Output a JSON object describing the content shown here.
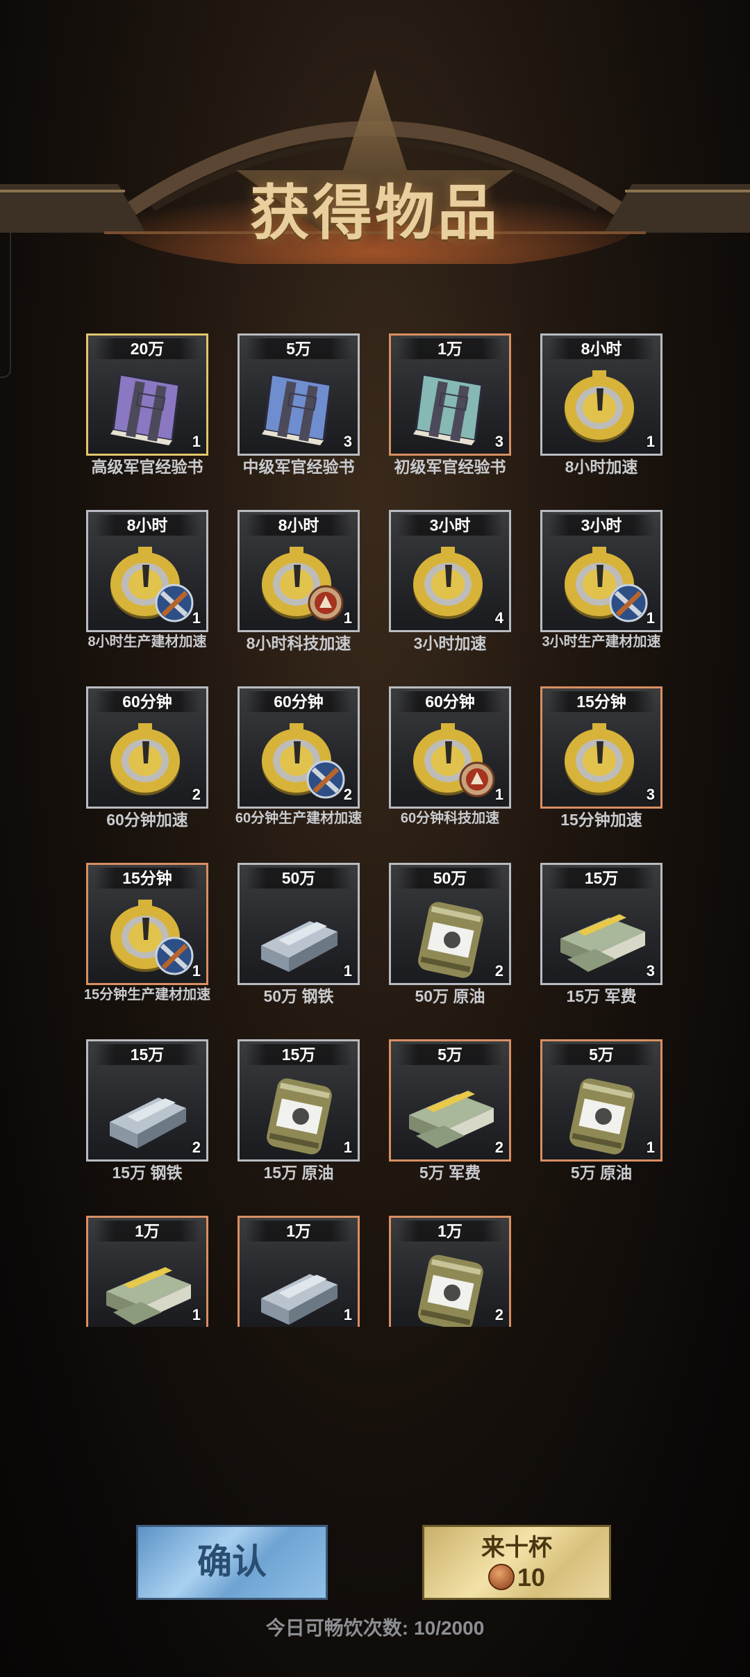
{
  "header": {
    "title": "获得物品"
  },
  "items": [
    {
      "tag": "20万",
      "qty": "1",
      "name": "高级军官经验书",
      "icon": "book-purple",
      "border": "gold"
    },
    {
      "tag": "5万",
      "qty": "3",
      "name": "中级军官经验书",
      "icon": "book-blue",
      "border": "silver"
    },
    {
      "tag": "1万",
      "qty": "3",
      "name": "初级军官经验书",
      "icon": "book-teal",
      "border": "orange"
    },
    {
      "tag": "8小时",
      "qty": "1",
      "name": "8小时加速",
      "icon": "speedup",
      "border": "silver"
    },
    {
      "tag": "8小时",
      "qty": "1",
      "name": "8小时生产建材加速",
      "icon": "speedup-build",
      "border": "silver"
    },
    {
      "tag": "8小时",
      "qty": "1",
      "name": "8小时科技加速",
      "icon": "speedup-tech",
      "border": "silver"
    },
    {
      "tag": "3小时",
      "qty": "4",
      "name": "3小时加速",
      "icon": "speedup",
      "border": "silver"
    },
    {
      "tag": "3小时",
      "qty": "1",
      "name": "3小时生产建材加速",
      "icon": "speedup-build",
      "border": "silver"
    },
    {
      "tag": "60分钟",
      "qty": "2",
      "name": "60分钟加速",
      "icon": "speedup",
      "border": "silver"
    },
    {
      "tag": "60分钟",
      "qty": "2",
      "name": "60分钟生产建材加速",
      "icon": "speedup-build",
      "border": "silver"
    },
    {
      "tag": "60分钟",
      "qty": "1",
      "name": "60分钟科技加速",
      "icon": "speedup-tech",
      "border": "silver"
    },
    {
      "tag": "15分钟",
      "qty": "3",
      "name": "15分钟加速",
      "icon": "speedup",
      "border": "orange"
    },
    {
      "tag": "15分钟",
      "qty": "1",
      "name": "15分钟生产建材加速",
      "icon": "speedup-build",
      "border": "orange"
    },
    {
      "tag": "50万",
      "qty": "1",
      "name": "50万 钢铁",
      "icon": "steel",
      "border": "silver"
    },
    {
      "tag": "50万",
      "qty": "2",
      "name": "50万 原油",
      "icon": "oil",
      "border": "silver"
    },
    {
      "tag": "15万",
      "qty": "3",
      "name": "15万 军费",
      "icon": "cash",
      "border": "silver"
    },
    {
      "tag": "15万",
      "qty": "2",
      "name": "15万 钢铁",
      "icon": "steel",
      "border": "silver"
    },
    {
      "tag": "15万",
      "qty": "1",
      "name": "15万 原油",
      "icon": "oil",
      "border": "silver"
    },
    {
      "tag": "5万",
      "qty": "2",
      "name": "5万 军费",
      "icon": "cash",
      "border": "orange"
    },
    {
      "tag": "5万",
      "qty": "1",
      "name": "5万 原油",
      "icon": "oil",
      "border": "orange"
    },
    {
      "tag": "1万",
      "qty": "1",
      "name": "",
      "icon": "cash",
      "border": "orange"
    },
    {
      "tag": "1万",
      "qty": "1",
      "name": "",
      "icon": "steel",
      "border": "orange"
    },
    {
      "tag": "1万",
      "qty": "2",
      "name": "",
      "icon": "oil",
      "border": "orange"
    }
  ],
  "buttons": {
    "confirm": "确认",
    "ten_title": "来十杯",
    "ten_cost": "10"
  },
  "footer": {
    "label": "今日可畅饮次数:",
    "count": "10/2000"
  },
  "colors": {
    "gold_border": "#e2c66e",
    "orange_border": "#d98f62",
    "silver_border": "#b8bcc2",
    "title": "#e8cf9d"
  }
}
